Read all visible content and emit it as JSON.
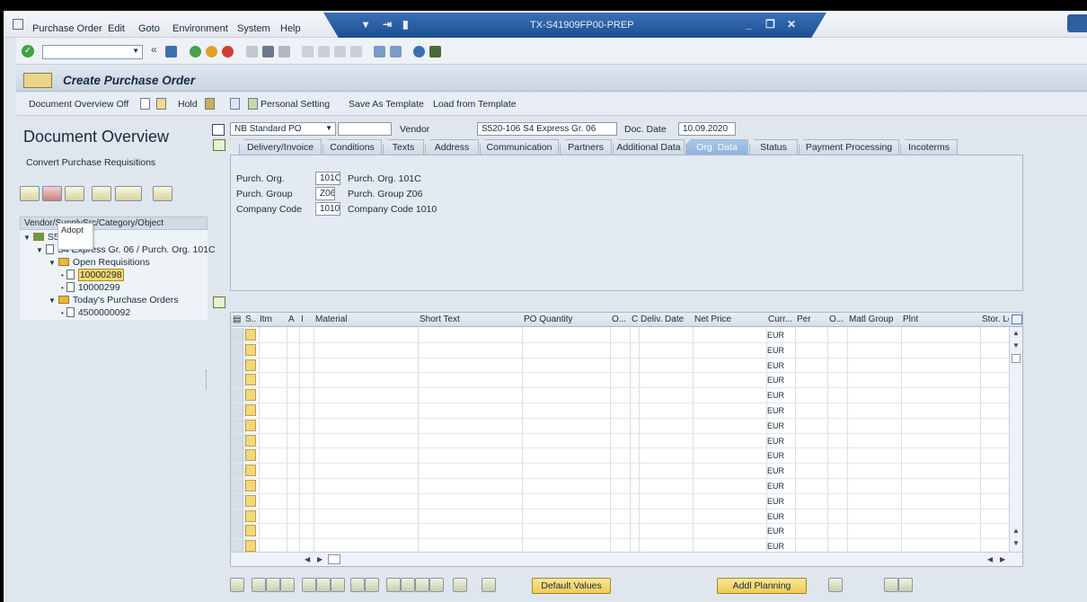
{
  "menu": {
    "items": [
      "Purchase Order",
      "Edit",
      "Goto",
      "Environment",
      "System",
      "Help"
    ]
  },
  "window": {
    "system_name": "TX-S41909FP00-PREP"
  },
  "title": "Create Purchase Order",
  "app_toolbar": {
    "doc_overview": "Document Overview Off",
    "hold": "Hold",
    "personal_setting": "Personal Setting",
    "save_template": "Save As Template",
    "load_template": "Load from Template"
  },
  "left_panel": {
    "heading": "Document Overview",
    "sub": "Convert Purchase Requisitions",
    "tooltip": "Adopt",
    "tree_header": "Vendor/SupplySrc/Category/Object",
    "tree": [
      {
        "label": "S5",
        "level": 0
      },
      {
        "label": "S4 Express Gr. 06 / Purch. Org. 101C",
        "level": 1
      },
      {
        "label": "Open Requisitions",
        "level": 2
      },
      {
        "label": "10000298",
        "level": 3,
        "selected": true
      },
      {
        "label": "10000299",
        "level": 3
      },
      {
        "label": "Today's Purchase Orders",
        "level": 2
      },
      {
        "label": "4500000092",
        "level": 3
      }
    ]
  },
  "header": {
    "doc_type": "NB Standard PO",
    "vendor_label": "Vendor",
    "vendor_value": "S520-106 S4 Express Gr. 06",
    "doc_date_label": "Doc. Date",
    "doc_date_value": "10.09.2020"
  },
  "tabs": [
    "Delivery/Invoice",
    "Conditions",
    "Texts",
    "Address",
    "Communication",
    "Partners",
    "Additional Data",
    "Org. Data",
    "Status",
    "Payment Processing",
    "Incoterms"
  ],
  "active_tab": "Org. Data",
  "org_data": {
    "purch_org_label": "Purch. Org.",
    "purch_org_value": "101C",
    "purch_org_desc": "Purch. Org. 101C",
    "purch_group_label": "Purch. Group",
    "purch_group_value": "Z06",
    "purch_group_desc": "Purch. Group Z06",
    "company_code_label": "Company Code",
    "company_code_value": "1010",
    "company_code_desc": "Company Code 1010"
  },
  "grid": {
    "columns": [
      "S..",
      "Itm",
      "A",
      "I",
      "Material",
      "Short Text",
      "PO Quantity",
      "O...",
      "C",
      "Deliv. Date",
      "Net Price",
      "Curr...",
      "Per",
      "O...",
      "Matl Group",
      "Plnt",
      "Stor. Lo"
    ],
    "currency": "EUR",
    "row_count": 15
  },
  "bottom": {
    "default_values": "Default Values",
    "addl_planning": "Addl Planning"
  }
}
